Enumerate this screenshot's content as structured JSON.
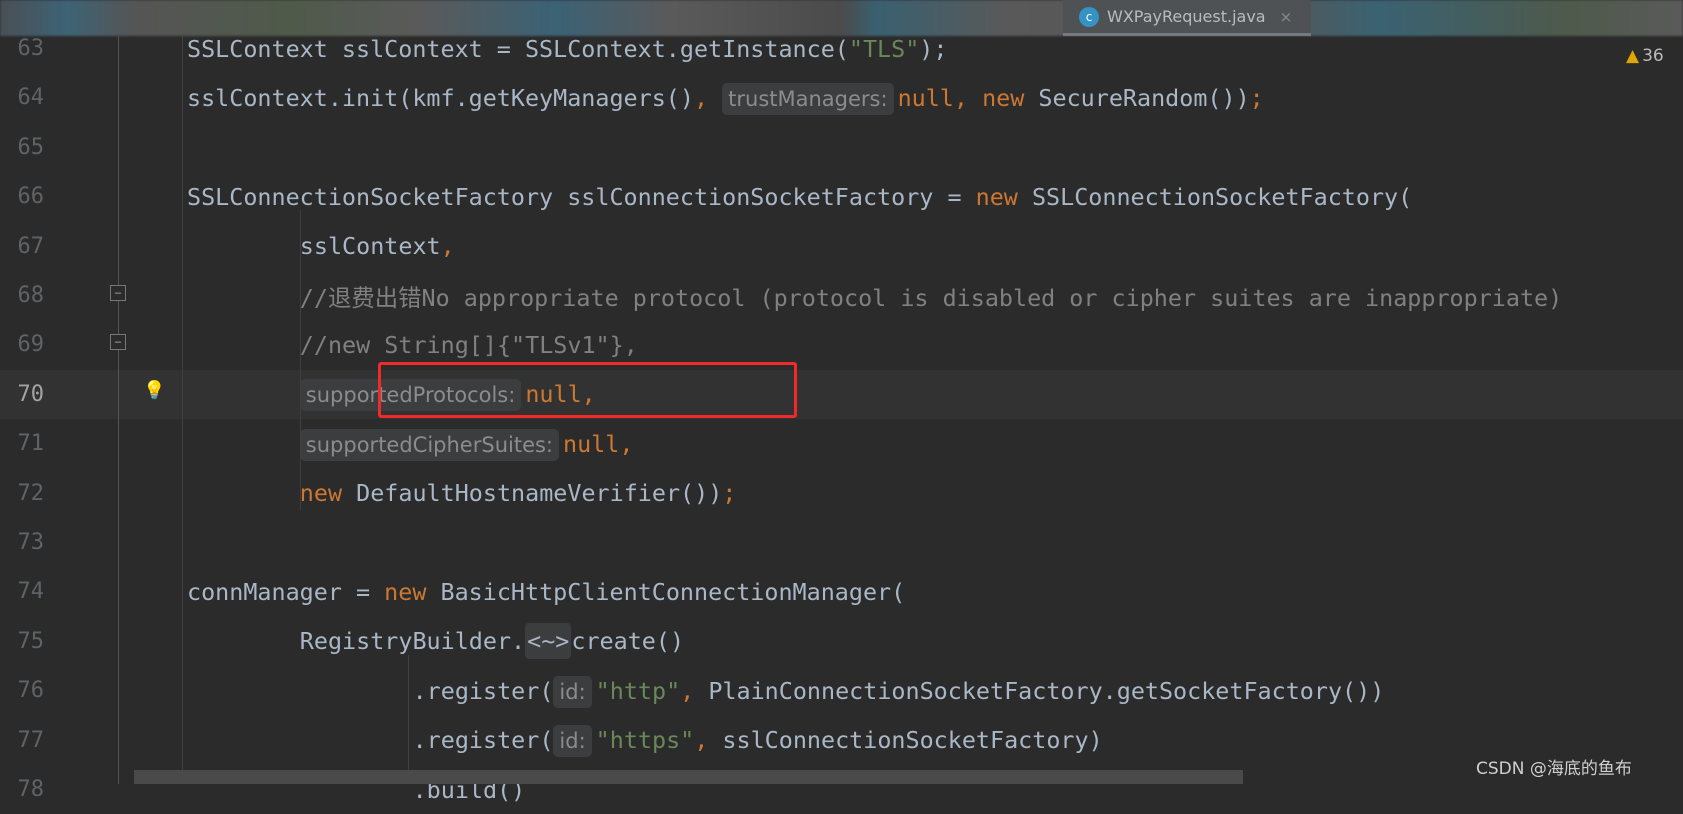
{
  "tab": {
    "icon": "class-c-icon",
    "icon_letter": "c",
    "title": "WXPayRequest.java",
    "close": "×"
  },
  "inspections": {
    "icon": "warning-icon",
    "glyph": "▲",
    "count": "36"
  },
  "watermark": "CSDN @海底的鱼布",
  "lines": [
    {
      "num": "63",
      "indent": 8,
      "tokens": [
        {
          "t": "SSLContext sslContext = SSLContext.getInstance(",
          "k": "plain"
        },
        {
          "t": "\"TLS\"",
          "k": "string"
        },
        {
          "t": ");",
          "k": "plain"
        }
      ]
    },
    {
      "num": "64",
      "indent": 8,
      "tokens": [
        {
          "t": "sslContext.init(kmf.getKeyManagers()",
          "k": "plain"
        },
        {
          "t": ", ",
          "k": "punct"
        },
        {
          "t": "trustManagers:",
          "k": "hint"
        },
        {
          "t": "null",
          "k": "keyword"
        },
        {
          "t": ", ",
          "k": "punct"
        },
        {
          "t": "new ",
          "k": "keyword"
        },
        {
          "t": "SecureRandom())",
          "k": "plain"
        },
        {
          "t": ";",
          "k": "punct"
        }
      ]
    },
    {
      "num": "65",
      "indent": 8,
      "tokens": []
    },
    {
      "num": "66",
      "indent": 8,
      "tokens": [
        {
          "t": "SSLConnectionSocketFactory sslConnectionSocketFactory = ",
          "k": "plain"
        },
        {
          "t": "new ",
          "k": "keyword"
        },
        {
          "t": "SSLConnectionSocketFactory(",
          "k": "plain"
        }
      ]
    },
    {
      "num": "67",
      "indent": 16,
      "tokens": [
        {
          "t": "sslContext",
          "k": "plain"
        },
        {
          "t": ",",
          "k": "punct"
        }
      ]
    },
    {
      "num": "68",
      "indent": 16,
      "tokens": [
        {
          "t": "//退费出错No appropriate protocol (protocol is disabled or cipher suites are inappropriate)",
          "k": "comment"
        }
      ]
    },
    {
      "num": "69",
      "indent": 16,
      "tokens": [
        {
          "t": "//new String[]{\"TLSv1\"},",
          "k": "comment"
        }
      ]
    },
    {
      "num": "70",
      "indent": 16,
      "current": true,
      "tokens": [
        {
          "t": "supportedProtocols:",
          "k": "hint"
        },
        {
          "t": "null",
          "k": "keyword"
        },
        {
          "t": ",",
          "k": "punct"
        }
      ]
    },
    {
      "num": "71",
      "indent": 16,
      "tokens": [
        {
          "t": "supportedCipherSuites:",
          "k": "hint"
        },
        {
          "t": "null",
          "k": "keyword"
        },
        {
          "t": ",",
          "k": "punct"
        }
      ]
    },
    {
      "num": "72",
      "indent": 16,
      "tokens": [
        {
          "t": "new ",
          "k": "keyword"
        },
        {
          "t": "DefaultHostnameVerifier())",
          "k": "plain"
        },
        {
          "t": ";",
          "k": "punct"
        }
      ]
    },
    {
      "num": "73",
      "indent": 8,
      "tokens": []
    },
    {
      "num": "74",
      "indent": 8,
      "tokens": [
        {
          "t": "connManager = ",
          "k": "plain"
        },
        {
          "t": "new ",
          "k": "keyword"
        },
        {
          "t": "BasicHttpClientConnectionManager(",
          "k": "plain"
        }
      ]
    },
    {
      "num": "75",
      "indent": 16,
      "tokens": [
        {
          "t": "RegistryBuilder.",
          "k": "plain"
        },
        {
          "t": "<~>",
          "k": "fold"
        },
        {
          "t": "create()",
          "k": "plain"
        }
      ]
    },
    {
      "num": "76",
      "indent": 24,
      "tokens": [
        {
          "t": ".register(",
          "k": "plain"
        },
        {
          "t": "id:",
          "k": "hint"
        },
        {
          "t": "\"http\"",
          "k": "string"
        },
        {
          "t": ", ",
          "k": "punct"
        },
        {
          "t": "PlainConnectionSocketFactory.getSocketFactory())",
          "k": "plain"
        }
      ]
    },
    {
      "num": "77",
      "indent": 24,
      "tokens": [
        {
          "t": ".register(",
          "k": "plain"
        },
        {
          "t": "id:",
          "k": "hint"
        },
        {
          "t": "\"https\"",
          "k": "string"
        },
        {
          "t": ", ",
          "k": "punct"
        },
        {
          "t": "sslConnectionSocketFactory)",
          "k": "plain"
        }
      ]
    },
    {
      "num": "78",
      "indent": 24,
      "tokens": [
        {
          "t": ".build()",
          "k": "plain"
        }
      ]
    }
  ]
}
